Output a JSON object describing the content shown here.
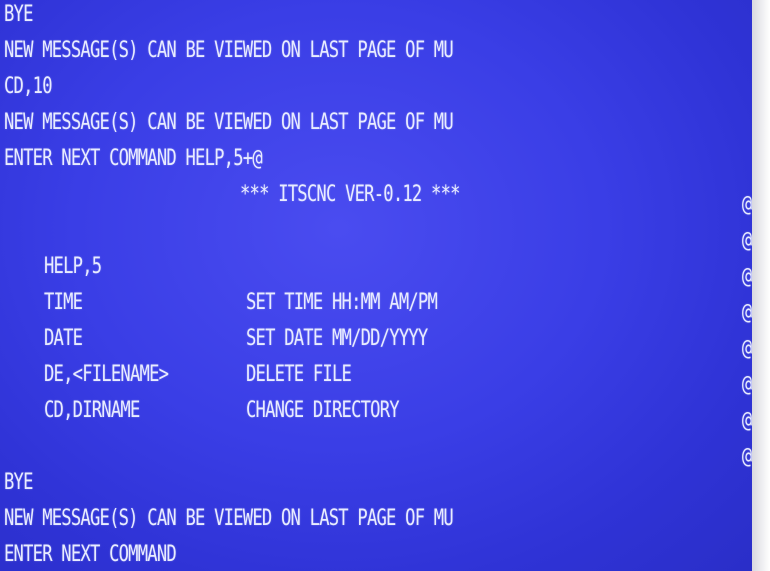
{
  "terminal": {
    "lines_top": [
      "BYE",
      "NEW MESSAGE(S) CAN BE VIEWED ON LAST PAGE OF MU",
      "CD,10",
      "NEW MESSAGE(S) CAN BE VIEWED ON LAST PAGE OF MU",
      "ENTER NEXT COMMAND HELP,5+@"
    ],
    "banner": "*** ITSCNC VER-0.12 ***",
    "help_title": "HELP,5",
    "help_rows": [
      {
        "command": "TIME",
        "description": "SET TIME HH:MM AM/PM"
      },
      {
        "command": "DATE",
        "description": "SET DATE MM/DD/YYYY"
      },
      {
        "command": "DE,<FILENAME>",
        "description": "DELETE FILE"
      },
      {
        "command": "CD,DIRNAME",
        "description": "CHANGE DIRECTORY"
      }
    ],
    "right_margin_char": "@",
    "lines_bottom": [
      "BYE",
      "NEW MESSAGE(S) CAN BE VIEWED ON LAST PAGE OF MU",
      "ENTER NEXT COMMAND"
    ]
  },
  "colors": {
    "screen_bg": "#3a3ee6",
    "text": "#e8ecff"
  }
}
